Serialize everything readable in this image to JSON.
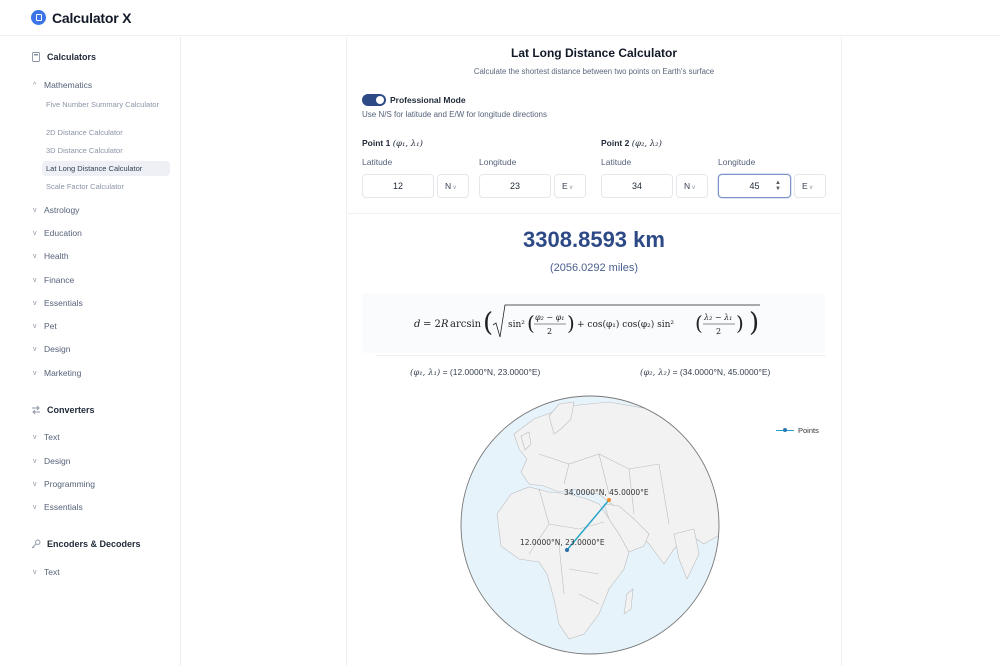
{
  "app": {
    "title": "Calculator X",
    "logo_icon": "calculator-icon"
  },
  "sidebar": {
    "sections": [
      {
        "title": "Calculators",
        "icon": "calculator-icon",
        "categories": [
          {
            "label": "Mathematics",
            "expanded": true,
            "items": [
              {
                "label": "Five Number Summary Calculator",
                "active": false
              },
              {
                "label": "2D Distance Calculator",
                "active": false
              },
              {
                "label": "3D Distance Calculator",
                "active": false
              },
              {
                "label": "Lat Long Distance Calculator",
                "active": true
              },
              {
                "label": "Scale Factor Calculator",
                "active": false
              }
            ]
          },
          {
            "label": "Astrology"
          },
          {
            "label": "Education"
          },
          {
            "label": "Health"
          },
          {
            "label": "Finance"
          },
          {
            "label": "Essentials"
          },
          {
            "label": "Pet"
          },
          {
            "label": "Design"
          },
          {
            "label": "Marketing"
          }
        ]
      },
      {
        "title": "Converters",
        "icon": "arrows-swap-icon",
        "categories": [
          {
            "label": "Text"
          },
          {
            "label": "Design"
          },
          {
            "label": "Programming"
          },
          {
            "label": "Essentials"
          }
        ]
      },
      {
        "title": "Encoders & Decoders",
        "icon": "key-icon",
        "categories": [
          {
            "label": "Text"
          }
        ]
      }
    ]
  },
  "main": {
    "title": "Lat Long Distance Calculator",
    "subtitle": "Calculate the shortest distance between two points on Earth's surface",
    "professional_mode": {
      "label": "Professional Mode",
      "enabled": true
    },
    "hint": "Use N/S for latitude and E/W for longitude directions",
    "point1": {
      "heading": "Point 1",
      "math": "(φ₁, λ₁)",
      "latitude_label": "Latitude",
      "longitude_label": "Longitude",
      "latitude": "12",
      "lat_dir": "N",
      "longitude": "23",
      "lon_dir": "E"
    },
    "point2": {
      "heading": "Point 2",
      "math": "(φ₂, λ₂)",
      "latitude_label": "Latitude",
      "longitude_label": "Longitude",
      "latitude": "34",
      "lat_dir": "N",
      "longitude": "45",
      "lon_dir": "E"
    },
    "result_km": "3308.8593 km",
    "result_miles": "(2056.0292 miles)",
    "formula": "d = 2R arcsin ( √( sin²((φ₂ − φ₁)/2) + cos(φ₁) cos(φ₂) sin²((λ₂ − λ₁)/2) ) )",
    "coord1_math": "(φ₁, λ₁)",
    "coord1_value": "= (12.0000°N, 23.0000°E)",
    "coord2_math": "(φ₂, λ₂)",
    "coord2_value": "= (34.0000°N, 45.0000°E)",
    "map": {
      "legend": "Points",
      "line_color": "#1fa2c6",
      "ocean_color": "#e6f3fb",
      "land_color": "#f2f2f2",
      "point1_label": "12.0000°N, 23.0000°E",
      "point2_label": "34.0000°N, 45.0000°E",
      "point1_color": "#2a6ca8",
      "point2_color": "#f28c28"
    }
  }
}
